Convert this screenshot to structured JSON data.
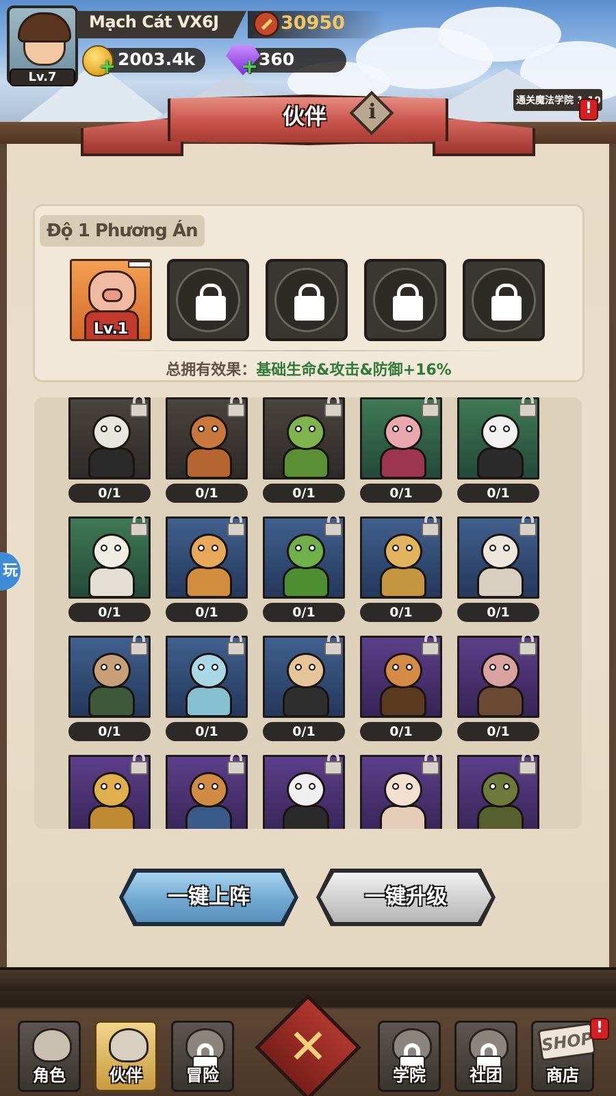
{
  "player": {
    "name": "Mạch Cát VX6J",
    "level": "Lv.7",
    "power": "30950",
    "gold": "2003.4k",
    "gems": "360"
  },
  "quest": {
    "label": "通关魔法学院 1-10"
  },
  "header": {
    "title": "伙伴",
    "info_glyph": "i"
  },
  "formation": {
    "label": "Độ 1 Phương Án",
    "slots": [
      {
        "state": "unlocked",
        "level": "Lv.1"
      },
      {
        "state": "locked"
      },
      {
        "state": "locked"
      },
      {
        "state": "locked"
      },
      {
        "state": "locked"
      }
    ],
    "effect_label": "总拥有效果：",
    "effect_value": "基础生命&攻击&防御+16%"
  },
  "collection": {
    "cards": [
      {
        "count": "0/1",
        "bg": "dark",
        "head": "#e8e4de",
        "body": "#2a2a2a"
      },
      {
        "count": "0/1",
        "bg": "dark",
        "head": "#c9773c",
        "body": "#b5652f"
      },
      {
        "count": "0/1",
        "bg": "dark",
        "head": "#7fb34d",
        "body": "#5b8f36"
      },
      {
        "count": "0/1",
        "bg": "green",
        "head": "#e9a7b0",
        "body": "#9c3550"
      },
      {
        "count": "0/1",
        "bg": "green",
        "head": "#f2f2f2",
        "body": "#2b2b2b"
      },
      {
        "count": "0/1",
        "bg": "green",
        "head": "#efece4",
        "body": "#e5e0d6"
      },
      {
        "count": "0/1",
        "bg": "blue",
        "head": "#e7a85a",
        "body": "#d28c3e"
      },
      {
        "count": "0/1",
        "bg": "blue",
        "head": "#6fb04a",
        "body": "#4f8f34"
      },
      {
        "count": "0/1",
        "bg": "blue",
        "head": "#e2b45e",
        "body": "#c4963f"
      },
      {
        "count": "0/1",
        "bg": "blue",
        "head": "#ece6dc",
        "body": "#d9cfc0"
      },
      {
        "count": "0/1",
        "bg": "blue",
        "head": "#c7a07a",
        "body": "#3f5a3a"
      },
      {
        "count": "0/1",
        "bg": "blue",
        "head": "#a9d9e6",
        "body": "#87c0d1"
      },
      {
        "count": "0/1",
        "bg": "blue",
        "head": "#e6c49a",
        "body": "#2e2e2e"
      },
      {
        "count": "0/1",
        "bg": "purple",
        "head": "#d48b45",
        "body": "#5b3a22"
      },
      {
        "count": "0/1",
        "bg": "purple",
        "head": "#d9a2a0",
        "body": "#6b4a35"
      },
      {
        "count": "",
        "bg": "purple",
        "head": "#e0b04e",
        "body": "#c08a34"
      },
      {
        "count": "",
        "bg": "purple",
        "head": "#d08a44",
        "body": "#3a5a8a"
      },
      {
        "count": "",
        "bg": "purple",
        "head": "#f0f0f0",
        "body": "#2b2b2b"
      },
      {
        "count": "",
        "bg": "purple",
        "head": "#f3e0d0",
        "body": "#e6cdb8"
      },
      {
        "count": "",
        "bg": "purple",
        "head": "#6d7a3c",
        "body": "#55602e"
      }
    ]
  },
  "actions": {
    "deploy_label": "一键上阵",
    "upgrade_label": "一键升级"
  },
  "nav": {
    "tabs": [
      {
        "label": "角色",
        "locked": false,
        "active": false
      },
      {
        "label": "伙伴",
        "locked": false,
        "active": true
      },
      {
        "label": "冒险",
        "locked": true,
        "active": false
      },
      {
        "label": "学院",
        "locked": true,
        "active": false
      },
      {
        "label": "社团",
        "locked": true,
        "active": false
      },
      {
        "label": "商店",
        "locked": false,
        "active": false
      }
    ],
    "shop_sign": "SHOP",
    "battle_glyph": "✕"
  },
  "side_float": "玩",
  "alert_glyph": "!",
  "colors": {
    "effect_green": "#2f7a38",
    "power_gold": "#f6c65a",
    "banner_red": "#c9544a"
  }
}
